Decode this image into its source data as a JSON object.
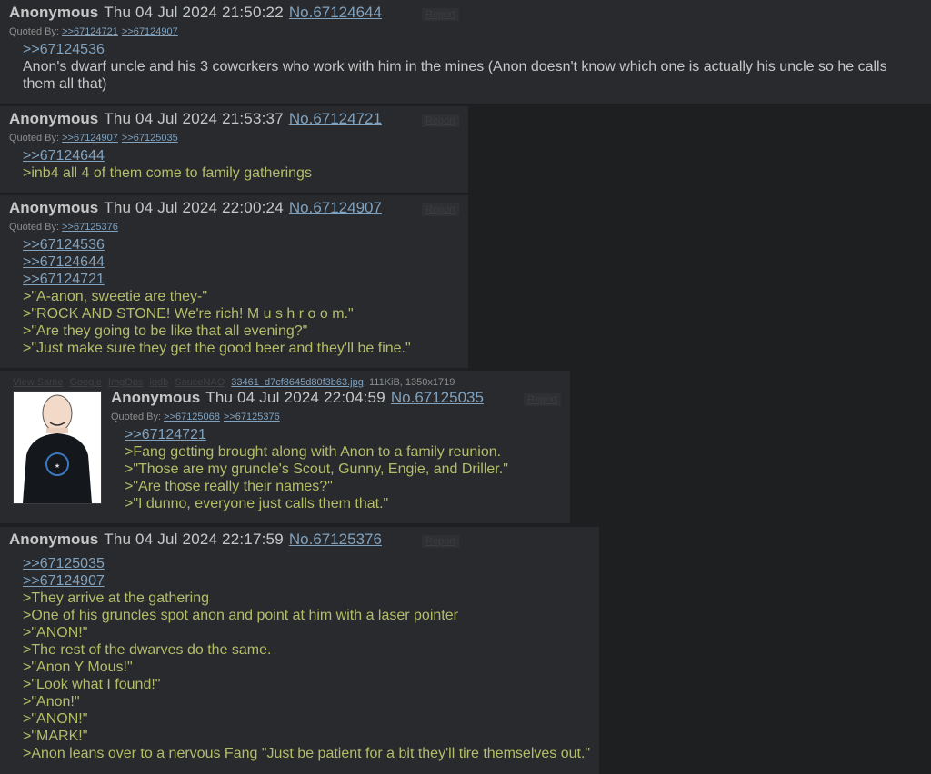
{
  "report_label": "Report",
  "quoted_by_label": "Quoted By:",
  "posts": [
    {
      "name": "Anonymous",
      "date": "Thu 04 Jul 2024 21:50:22",
      "num": "No.67124644",
      "quoted_by": [
        ">>67124721",
        ">>67124907"
      ],
      "lines": [
        {
          "t": ">>67124536"
        },
        {
          "t": "Anon's dwarf uncle and his 3 coworkers who work with him in the mines (Anon doesn't know which one is actually his uncle so he calls them all that)"
        }
      ]
    },
    {
      "name": "Anonymous",
      "date": "Thu 04 Jul 2024 21:53:37",
      "num": "No.67124721",
      "quoted_by": [
        ">>67124907",
        ">>67125035"
      ],
      "lines": [
        {
          "t": ">>67124644"
        },
        {
          "t": ">inb4 all 4 of them come to family gatherings"
        }
      ]
    },
    {
      "name": "Anonymous",
      "date": "Thu 04 Jul 2024 22:00:24",
      "num": "No.67124907",
      "quoted_by": [
        ">>67125376"
      ],
      "lines": [
        {
          "t": ">>67124536"
        },
        {
          "t": ">>67124644"
        },
        {
          "t": ">>67124721"
        },
        {
          "t": ">\"A-anon, sweetie are they-\""
        },
        {
          "t": ">\"ROCK AND STONE! We're rich! M u s h r o o m.\""
        },
        {
          "t": ">\"Are they going to be like that all evening?\""
        },
        {
          "t": ">\"Just make sure they get the good beer and they'll be fine.\""
        }
      ]
    },
    {
      "name": "Anonymous",
      "date": "Thu 04 Jul 2024 22:04:59",
      "num": "No.67125035",
      "quoted_by": [
        ">>67125068",
        ">>67125376"
      ],
      "file": {
        "faint_links": [
          "View Same",
          "Google",
          "ImgOps",
          "iqdb",
          "SauceNAO"
        ],
        "filename": "33461_d7cf8645d80f3b63.jpg",
        "meta": ", 111KiB, 1350x1719"
      },
      "lines": [
        {
          "t": ">>67124721"
        },
        {
          "t": ">Fang getting brought along with Anon to a family reunion."
        },
        {
          "t": ">\"Those are my gruncle's Scout, Gunny, Engie, and Driller.\""
        },
        {
          "t": ">\"Are those really their names?\""
        },
        {
          "t": ">\"I dunno, everyone just calls them that.\""
        }
      ]
    },
    {
      "name": "Anonymous",
      "date": "Thu 04 Jul 2024 22:17:59",
      "num": "No.67125376",
      "quoted_by": [],
      "lines": [
        {
          "t": ">>67125035"
        },
        {
          "t": ">>67124907"
        },
        {
          "t": ">They arrive at the gathering"
        },
        {
          "t": ">One of his gruncles spot anon and point at him with a laser pointer"
        },
        {
          "t": ">\"ANON!\""
        },
        {
          "t": ">The rest of the dwarves do the same."
        },
        {
          "t": ">\"Anon Y Mous!\""
        },
        {
          "t": ">\"Look what I found!\""
        },
        {
          "t": ">\"Anon!\""
        },
        {
          "t": ">\"ANON!\""
        },
        {
          "t": ">\"MARK!\""
        },
        {
          "t": ">Anon leans over to a nervous Fang \"Just be patient for a bit they'll tire themselves out.\""
        }
      ]
    }
  ]
}
